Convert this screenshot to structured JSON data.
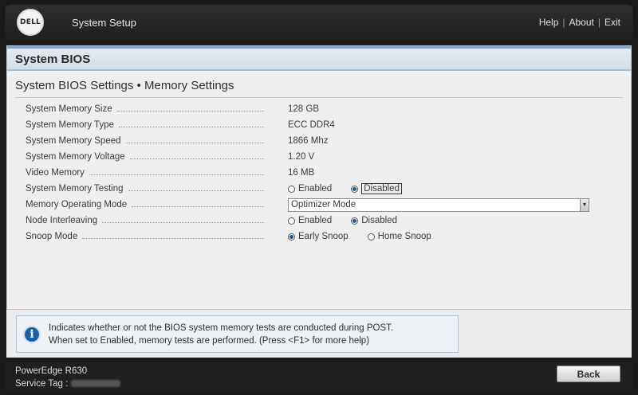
{
  "header": {
    "logo_text": "DELL",
    "app_title": "System Setup",
    "links": [
      "Help",
      "About",
      "Exit"
    ],
    "separator": "|"
  },
  "panel": {
    "title": "System BIOS",
    "subtitle": "System BIOS Settings • Memory Settings"
  },
  "settings": [
    {
      "label": "System Memory Size",
      "value": "128 GB"
    },
    {
      "label": "System Memory Type",
      "value": "ECC DDR4"
    },
    {
      "label": "System Memory Speed",
      "value": "1866 Mhz"
    },
    {
      "label": "System Memory Voltage",
      "value": "1.20 V"
    },
    {
      "label": "Video Memory",
      "value": "16 MB"
    },
    {
      "label": "System Memory Testing",
      "options": [
        "Enabled",
        "Disabled"
      ],
      "selected": "Disabled"
    },
    {
      "label": "Memory Operating Mode",
      "dropdown_value": "Optimizer Mode"
    },
    {
      "label": "Node Interleaving",
      "options": [
        "Enabled",
        "Disabled"
      ],
      "selected": "Disabled"
    },
    {
      "label": "Snoop Mode",
      "options": [
        "Early Snoop",
        "Home Snoop"
      ],
      "selected": "Early Snoop"
    }
  ],
  "help": {
    "icon": "info-icon",
    "line1": "Indicates whether or not the BIOS system memory tests are conducted during POST.",
    "line2": "When set to Enabled, memory tests are performed. (Press <F1> for more help)"
  },
  "footer": {
    "model": "PowerEdge R630",
    "service_tag_label": "Service Tag :",
    "back_label": "Back"
  },
  "colors": {
    "accent": "#1f5ea8",
    "header_bg": "#2e2e2e",
    "panel_head_border": "#7fa4c8"
  }
}
